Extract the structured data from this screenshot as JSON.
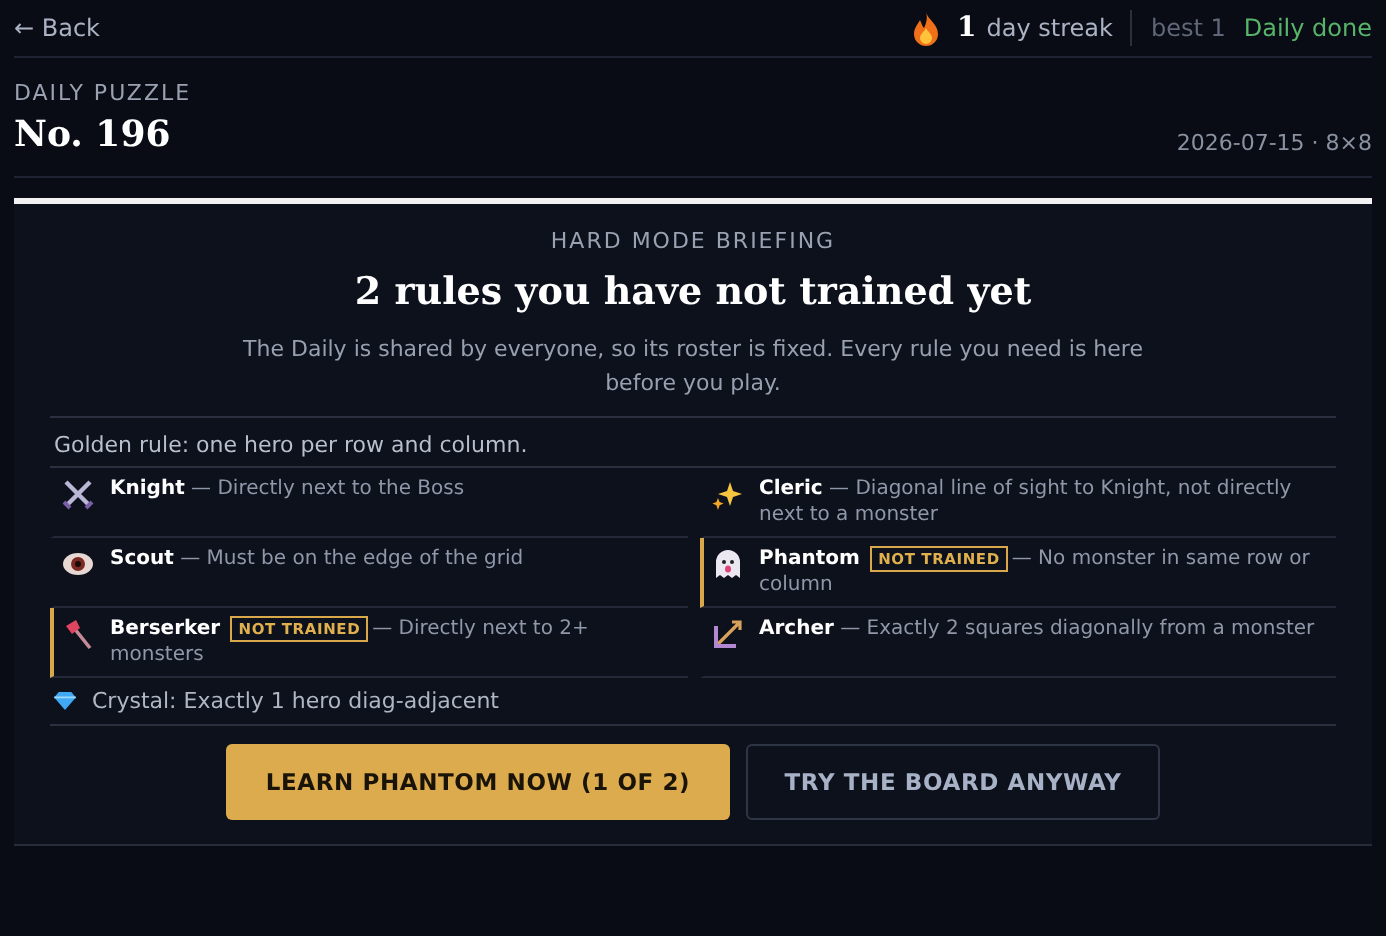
{
  "nav": {
    "back": "← Back",
    "streak_count": "1",
    "streak_label": "day streak",
    "best": "best 1",
    "status": "Daily done"
  },
  "header": {
    "eyebrow": "DAILY PUZZLE",
    "title": "No. 196",
    "meta": "2026-07-15 · 8×8"
  },
  "briefing": {
    "eyebrow": "HARD MODE BRIEFING",
    "title": "2 rules you have not trained yet",
    "intro": "The Daily is shared by everyone, so its roster is fixed. Every rule you need is here before you play.",
    "golden_rule": "Golden rule: one hero per row and column.",
    "rules": [
      {
        "name": "Knight",
        "trained": true,
        "description": "— Directly next to the Boss"
      },
      {
        "name": "Cleric",
        "trained": true,
        "description": "— Diagonal line of sight to Knight, not directly next to a monster"
      },
      {
        "name": "Scout",
        "trained": true,
        "description": "— Must be on the edge of the grid"
      },
      {
        "name": "Phantom",
        "trained": false,
        "badge": "NOT TRAINED",
        "description": "— No monster in same row or column"
      },
      {
        "name": "Berserker",
        "trained": false,
        "badge": "NOT TRAINED",
        "description": "— Directly next to 2+ monsters"
      },
      {
        "name": "Archer",
        "trained": true,
        "description": "— Exactly 2 squares diagonally from a monster"
      }
    ],
    "crystal": "Crystal: Exactly 1 hero diag-adjacent",
    "primary_button": "LEARN PHANTOM NOW (1 OF 2)",
    "secondary_button": "TRY THE BOARD ANYWAY"
  }
}
